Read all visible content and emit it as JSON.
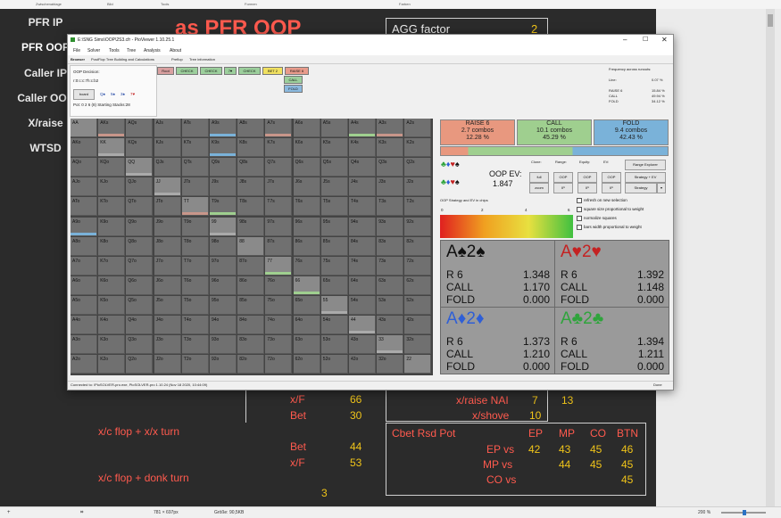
{
  "ribbon": {
    "groups": [
      "Zwischenablage",
      "Bild",
      "Tools",
      "Formen",
      "Farben"
    ]
  },
  "slide": {
    "nav_buttons": [
      "PFR IP",
      "PFR OOP",
      "Caller IP",
      "Caller OOP",
      "X/raise",
      "WTSD"
    ],
    "heading": "as PFR OOP",
    "agg_factor": {
      "label": "AGG factor",
      "value": "2"
    },
    "stats_left": [
      {
        "label": "x/F",
        "value": "66"
      },
      {
        "label": "Bet",
        "value": "30"
      }
    ],
    "xc_xx": "x/c flop + x/x turn",
    "stats_left2": [
      {
        "label": "Bet",
        "value": "44"
      },
      {
        "label": "x/F",
        "value": "53"
      }
    ],
    "xc_donk": "x/c flop + donk turn",
    "donk_value": "3",
    "xraise_nai": {
      "label": "x/raise NAI",
      "v1": "7",
      "v2": "13"
    },
    "xshove": {
      "label": "x/shove",
      "value": "10"
    },
    "cbet_table": {
      "title": "Cbet Rsd Pot",
      "headers": [
        "EP",
        "MP",
        "CO",
        "BTN"
      ],
      "rows": [
        {
          "label": "EP vs",
          "values": [
            "42",
            "43",
            "45",
            "46"
          ]
        },
        {
          "label": "MP vs",
          "values": [
            "",
            "44",
            "45",
            "45"
          ]
        },
        {
          "label": "CO vs",
          "values": [
            "",
            "",
            "",
            "45"
          ]
        }
      ]
    }
  },
  "statusbar": {
    "coords": "781 × 697px",
    "size": "Größe: 90,5KB",
    "zoom": "200 %"
  },
  "pio": {
    "title": "E:\\SNG Sims\\OOP\\2S3.cfr - PioViewer 1.10.25.1",
    "menu": [
      "File",
      "Solver",
      "Tools",
      "Tree",
      "Analysis",
      "About"
    ],
    "tabs": [
      "Browser",
      "PostFlop Tree Building and Calculations",
      "Preflop",
      "Tree information"
    ],
    "decision": "OOP Decision:",
    "line": "r:0:c:c:7h:c:b2",
    "board_button": "board",
    "board_cards": [
      "Q♠",
      "5♠",
      "3♠",
      "7♥"
    ],
    "pot": "Pot: 0 2 6 (8) Starting Stacks:28",
    "tree_chips": [
      {
        "label": "Root",
        "color": "#d9a0a0"
      },
      {
        "label": "CHECK",
        "color": "#9ccf9c"
      },
      {
        "label": "CHECK",
        "color": "#9ccf9c"
      },
      {
        "label": "7♥",
        "color": "#9ccf9c"
      },
      {
        "label": "CHECK",
        "color": "#9ccf9c"
      },
      {
        "label": "BET 2",
        "color": "#f0e060"
      },
      {
        "label": "RAISE 6",
        "color": "#e89b8b"
      }
    ],
    "sub_chips": [
      "CALL",
      "FOLD"
    ],
    "freq_panel": {
      "title": "Frequency across runouts:",
      "line_label": "Line:",
      "line_val": "0.07 %",
      "rows": [
        {
          "label": "RAISE 6",
          "value": "15.84 %"
        },
        {
          "label": "CALL",
          "value": "49.94 %"
        },
        {
          "label": "FOLD",
          "value": "34.12 %"
        }
      ]
    },
    "grid_labels": [
      [
        "AA",
        "AKs",
        "AQs",
        "AJs",
        "ATs",
        "A9s",
        "A8s",
        "A7s",
        "A6s",
        "A5s",
        "A4s",
        "A3s",
        "A2s"
      ],
      [
        "AKo",
        "KK",
        "KQs",
        "KJs",
        "KTs",
        "K9s",
        "K8s",
        "K7s",
        "K6s",
        "K5s",
        "K4s",
        "K3s",
        "K2s"
      ],
      [
        "AQo",
        "KQo",
        "QQ",
        "QJs",
        "QTs",
        "Q9s",
        "Q8s",
        "Q7s",
        "Q6s",
        "Q5s",
        "Q4s",
        "Q3s",
        "Q2s"
      ],
      [
        "AJo",
        "KJo",
        "QJo",
        "JJ",
        "JTs",
        "J9s",
        "J8s",
        "J7s",
        "J6s",
        "J5s",
        "J4s",
        "J3s",
        "J2s"
      ],
      [
        "ATo",
        "KTo",
        "QTo",
        "JTo",
        "TT",
        "T9s",
        "T8s",
        "T7s",
        "T6s",
        "T5s",
        "T4s",
        "T3s",
        "T2s"
      ],
      [
        "A9o",
        "K9o",
        "Q9o",
        "J9o",
        "T9o",
        "99",
        "98s",
        "97s",
        "96s",
        "95s",
        "94s",
        "93s",
        "92s"
      ],
      [
        "A8o",
        "K8o",
        "Q8o",
        "J8o",
        "T8o",
        "98o",
        "88",
        "87s",
        "86s",
        "85s",
        "84s",
        "83s",
        "82s"
      ],
      [
        "A7o",
        "K7o",
        "Q7o",
        "J7o",
        "T7o",
        "97o",
        "87o",
        "77",
        "76s",
        "75s",
        "74s",
        "73s",
        "72s"
      ],
      [
        "A6o",
        "K6o",
        "Q6o",
        "J6o",
        "T6o",
        "96o",
        "86o",
        "76o",
        "66",
        "65s",
        "64s",
        "63s",
        "62s"
      ],
      [
        "A5o",
        "K5o",
        "Q5o",
        "J5o",
        "T5o",
        "95o",
        "85o",
        "75o",
        "65o",
        "55",
        "54s",
        "53s",
        "52s"
      ],
      [
        "A4o",
        "K4o",
        "Q4o",
        "J4o",
        "T4o",
        "94o",
        "84o",
        "74o",
        "64o",
        "54o",
        "44",
        "43s",
        "42s"
      ],
      [
        "A3o",
        "K3o",
        "Q3o",
        "J3o",
        "T3o",
        "93o",
        "83o",
        "73o",
        "63o",
        "53o",
        "43o",
        "33",
        "32s"
      ],
      [
        "A2o",
        "K2o",
        "Q2o",
        "J2o",
        "T2o",
        "92o",
        "82o",
        "72o",
        "62o",
        "52o",
        "42o",
        "32o",
        "22"
      ]
    ],
    "strategy": [
      {
        "action": "RAISE 6",
        "combos": "2.7 combos",
        "pct": "12.28 %",
        "color": "#e8987f"
      },
      {
        "action": "CALL",
        "combos": "10.1 combos",
        "pct": "45.29 %",
        "color": "#9fcf8f"
      },
      {
        "action": "FOLD",
        "combos": "9.4 combos",
        "pct": "42.43 %",
        "color": "#7ab2d9"
      }
    ],
    "ev_label": "OOP EV:",
    "ev_value": "1.847",
    "controls_headers": [
      "Clone:",
      "Range:",
      "Equity:",
      "EV:"
    ],
    "buttons": [
      "full",
      "OOP",
      "OOP",
      "OOP",
      "zoom",
      "IP",
      "IP",
      "IP"
    ],
    "right_buttons": [
      "Range Explorer",
      "Strategy + EV",
      "Strategy"
    ],
    "legend_title": "OOP Strategy and EV in chips",
    "legend_ticks": [
      "0",
      "2",
      "4",
      "6"
    ],
    "checkboxes": [
      "refresh on new selection",
      "square size proportional to weight",
      "normalize squares",
      "bars width proportional to weight"
    ],
    "combos": [
      {
        "rank": "A♠2♠",
        "color": "#111111",
        "r": "1.348",
        "c": "1.170",
        "f": "0.000"
      },
      {
        "rank": "A♥2♥",
        "color": "#c42222",
        "r": "1.392",
        "c": "1.148",
        "f": "0.000"
      },
      {
        "rank": "A♦2♦",
        "color": "#2f5fd6",
        "r": "1.373",
        "c": "1.210",
        "f": "0.000"
      },
      {
        "rank": "A♣2♣",
        "color": "#2fa43c",
        "r": "1.394",
        "c": "1.211",
        "f": "0.000"
      }
    ],
    "combo_labels": [
      "R 6",
      "CALL",
      "FOLD"
    ],
    "status": "Connected to: \\PioSOLVER-pro.exe, PioSOLVER-pro 1.10.24 (Nov 18 2020, 10:44:09)",
    "status_right": "Done"
  }
}
